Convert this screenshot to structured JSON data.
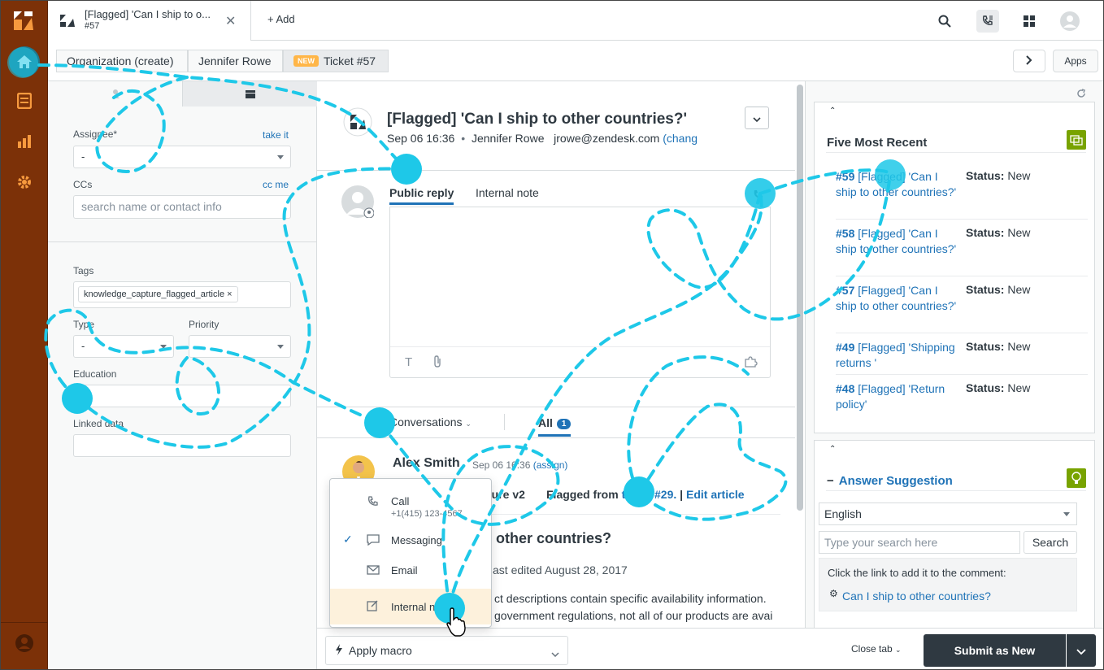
{
  "topbar": {
    "tab_title": "[Flagged] 'Can I ship to o...",
    "tab_sub": "#57",
    "add_label": "Add"
  },
  "breadcrumbs": {
    "org": "Organization (create)",
    "requester": "Jennifer Rowe",
    "new_badge": "NEW",
    "ticket": "Ticket #57",
    "apps_label": "Apps"
  },
  "props": {
    "assignee_label": "Assignee*",
    "take_it": "take it",
    "assignee_value": "-",
    "ccs_label": "CCs",
    "cc_me": "cc me",
    "ccs_placeholder": "search name or contact info",
    "tags_label": "Tags",
    "tag": "knowledge_capture_flagged_article",
    "type_label": "Type",
    "type_value": "-",
    "priority_label": "Priority",
    "priority_value": "-",
    "education_label": "Education",
    "linked_label": "Linked data"
  },
  "ticket": {
    "subject": "[Flagged] 'Can I ship to other countries?'",
    "date": "Sep 06 16:36",
    "requester": "Jennifer Rowe",
    "email": "jrowe@zendesk.com",
    "change": "(chang"
  },
  "reply": {
    "public_tab": "Public reply",
    "internal_tab": "Internal note"
  },
  "conversations": {
    "label": "Conversations",
    "all_label": "All",
    "count": "1"
  },
  "message": {
    "author": "Alex Smith",
    "time": "Sep 06 16:36",
    "assign": "(assign)",
    "line1_a": "ture v2",
    "line1_b": "Flagged from",
    "line1_link": "ticket #29.",
    "line1_sep": "|",
    "line1_edit": "Edit article",
    "heading": "other countries?",
    "edited": "ast edited August 28, 2017",
    "body1": "ct descriptions contain specific availability information.",
    "body2": "government regulations, not all of our products are avai"
  },
  "popup": {
    "call": "Call",
    "phone": "+1(415) 123-4567",
    "messaging": "Messaging",
    "email": "Email",
    "internal": "Internal note"
  },
  "recent": {
    "title": "Five Most Recent",
    "status_label": "Status:",
    "items": [
      {
        "num": "#59",
        "text": " [Flagged] 'Can I ship to other countries?'",
        "status": "New"
      },
      {
        "num": "#58",
        "text": " [Flagged] 'Can I ship to other countries?'",
        "status": "New"
      },
      {
        "num": "#57",
        "text": " [Flagged] 'Can I ship to other countries?'",
        "status": "New"
      },
      {
        "num": "#49",
        "text": " [Flagged] 'Shipping returns '",
        "status": "New"
      },
      {
        "num": "#48",
        "text": " [Flagged] 'Return policy'",
        "status": "New"
      }
    ]
  },
  "answer": {
    "title": "Answer Suggestion",
    "language": "English",
    "search_placeholder": "Type your search here",
    "search_btn": "Search",
    "hint": "Click the link to add it to the comment:",
    "suggestion": "Can I ship to other countries?"
  },
  "bottom": {
    "macro": "Apply macro",
    "close_tab": "Close tab",
    "submit": "Submit as New"
  },
  "colors": {
    "rail": "#7c3108",
    "accent": "#1f73b7",
    "trail": "#1ec8e8",
    "submit": "#2f3941"
  }
}
